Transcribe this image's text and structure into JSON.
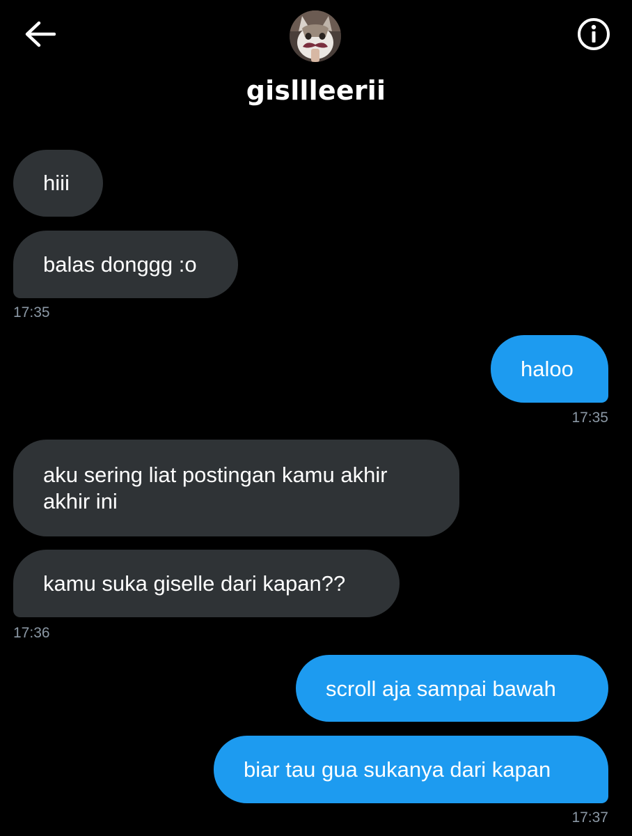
{
  "header": {
    "back_icon": "arrow-left-icon",
    "info_icon": "info-circle-icon",
    "avatar_icon": "cat-mustache-avatar",
    "username": "gisllleerii"
  },
  "colors": {
    "background": "#000000",
    "received_bubble": "#2f3336",
    "sent_bubble": "#1d9bf0",
    "timestamp": "#8b98a5",
    "text": "#ffffff"
  },
  "messages": [
    {
      "direction": "received",
      "text": "hiii"
    },
    {
      "direction": "received",
      "text": "balas donggg :o",
      "time": "17:35"
    },
    {
      "direction": "sent",
      "text": "haloo",
      "time": "17:35"
    },
    {
      "direction": "received",
      "text": "aku sering liat postingan kamu akhir akhir ini"
    },
    {
      "direction": "received",
      "text": "kamu suka giselle dari kapan??",
      "time": "17:36"
    },
    {
      "direction": "sent",
      "text": "scroll aja sampai bawah"
    },
    {
      "direction": "sent",
      "text": "biar tau gua sukanya dari kapan",
      "time": "17:37"
    }
  ]
}
